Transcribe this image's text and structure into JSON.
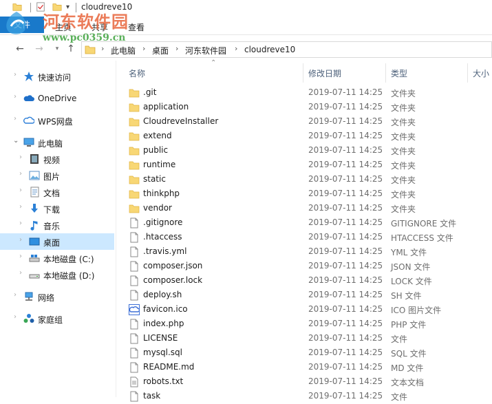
{
  "window": {
    "title": "cloudreve10"
  },
  "ribbon": {
    "file_tab": "文件",
    "tabs": [
      "主页",
      "共享",
      "查看"
    ]
  },
  "watermark": {
    "text": "河东软件园",
    "url": "www.pc0359.cn"
  },
  "address": {
    "segments": [
      "此电脑",
      "桌面",
      "河东软件园",
      "cloudreve10"
    ]
  },
  "sidebar": {
    "items": [
      {
        "label": "快速访问",
        "icon": "star-icon"
      },
      {
        "label": "OneDrive",
        "icon": "onedrive-cloud-icon"
      },
      {
        "label": "WPS网盘",
        "icon": "wps-cloud-icon"
      },
      {
        "label": "此电脑",
        "icon": "computer-icon"
      },
      {
        "label": "视频",
        "icon": "video-icon"
      },
      {
        "label": "图片",
        "icon": "pictures-icon"
      },
      {
        "label": "文档",
        "icon": "documents-icon"
      },
      {
        "label": "下载",
        "icon": "download-icon"
      },
      {
        "label": "音乐",
        "icon": "music-icon"
      },
      {
        "label": "桌面",
        "icon": "desktop-icon",
        "selected": true
      },
      {
        "label": "本地磁盘 (C:)",
        "icon": "drive-c-icon"
      },
      {
        "label": "本地磁盘 (D:)",
        "icon": "drive-icon"
      },
      {
        "label": "网络",
        "icon": "network-icon"
      },
      {
        "label": "家庭组",
        "icon": "homegroup-icon"
      }
    ]
  },
  "columns": {
    "name": "名称",
    "date": "修改日期",
    "type": "类型",
    "size": "大小"
  },
  "files": [
    {
      "name": ".git",
      "date": "2019-07-11 14:25",
      "type": "文件夹",
      "icon": "folder-icon"
    },
    {
      "name": "application",
      "date": "2019-07-11 14:25",
      "type": "文件夹",
      "icon": "folder-icon"
    },
    {
      "name": "CloudreveInstaller",
      "date": "2019-07-11 14:25",
      "type": "文件夹",
      "icon": "folder-icon"
    },
    {
      "name": "extend",
      "date": "2019-07-11 14:25",
      "type": "文件夹",
      "icon": "folder-icon"
    },
    {
      "name": "public",
      "date": "2019-07-11 14:25",
      "type": "文件夹",
      "icon": "folder-icon"
    },
    {
      "name": "runtime",
      "date": "2019-07-11 14:25",
      "type": "文件夹",
      "icon": "folder-icon"
    },
    {
      "name": "static",
      "date": "2019-07-11 14:25",
      "type": "文件夹",
      "icon": "folder-icon"
    },
    {
      "name": "thinkphp",
      "date": "2019-07-11 14:25",
      "type": "文件夹",
      "icon": "folder-icon"
    },
    {
      "name": "vendor",
      "date": "2019-07-11 14:25",
      "type": "文件夹",
      "icon": "folder-icon"
    },
    {
      "name": ".gitignore",
      "date": "2019-07-11 14:25",
      "type": "GITIGNORE 文件",
      "icon": "file-icon"
    },
    {
      "name": ".htaccess",
      "date": "2019-07-11 14:25",
      "type": "HTACCESS 文件",
      "icon": "file-icon"
    },
    {
      "name": ".travis.yml",
      "date": "2019-07-11 14:25",
      "type": "YML 文件",
      "icon": "file-icon"
    },
    {
      "name": "composer.json",
      "date": "2019-07-11 14:25",
      "type": "JSON 文件",
      "icon": "file-icon"
    },
    {
      "name": "composer.lock",
      "date": "2019-07-11 14:25",
      "type": "LOCK 文件",
      "icon": "file-icon"
    },
    {
      "name": "deploy.sh",
      "date": "2019-07-11 14:25",
      "type": "SH 文件",
      "icon": "file-icon"
    },
    {
      "name": "favicon.ico",
      "date": "2019-07-11 14:25",
      "type": "ICO 图片文件",
      "icon": "favicon-icon"
    },
    {
      "name": "index.php",
      "date": "2019-07-11 14:25",
      "type": "PHP 文件",
      "icon": "file-icon"
    },
    {
      "name": "LICENSE",
      "date": "2019-07-11 14:25",
      "type": "文件",
      "icon": "file-icon"
    },
    {
      "name": "mysql.sql",
      "date": "2019-07-11 14:25",
      "type": "SQL 文件",
      "icon": "file-icon"
    },
    {
      "name": "README.md",
      "date": "2019-07-11 14:25",
      "type": "MD 文件",
      "icon": "file-icon"
    },
    {
      "name": "robots.txt",
      "date": "2019-07-11 14:25",
      "type": "文本文档",
      "icon": "text-file-icon"
    },
    {
      "name": "task",
      "date": "2019-07-11 14:25",
      "type": "文件",
      "icon": "file-icon"
    }
  ],
  "colors": {
    "accent": "#1979ca",
    "selection": "#cce8ff",
    "folder": "#f8d775"
  }
}
